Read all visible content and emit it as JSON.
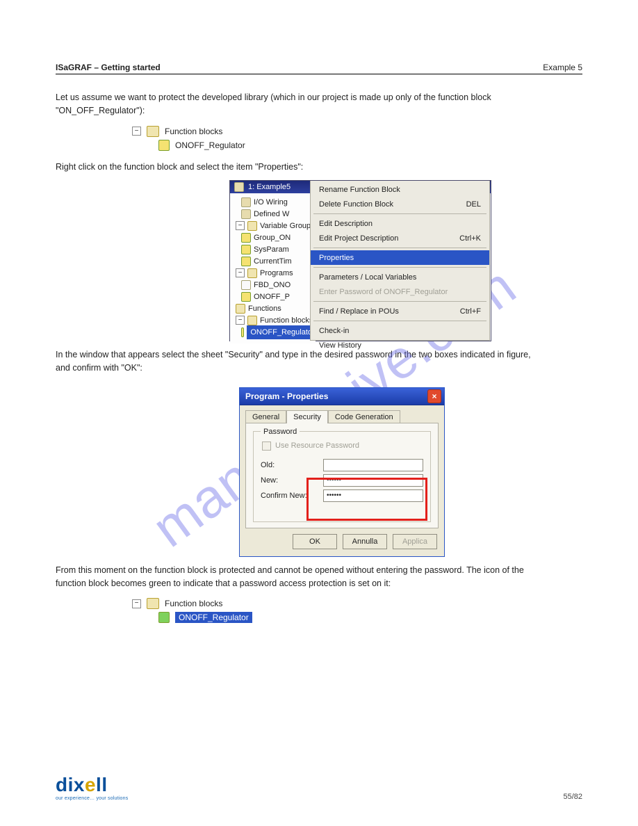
{
  "header": {
    "left": "ISaGRAF – Getting started",
    "right": "Example 5"
  },
  "para1": "Let us assume we want to protect the developed library (which in our project is made up only of the function block \"ON_OFF_Regulator\"):",
  "tree_mini1": {
    "parent": "Function blocks",
    "child": "ONOFF_Regulator"
  },
  "para2": "Right click on the function block and select the item \"Properties\":",
  "shot1": {
    "title": "1: Example5",
    "tree": [
      {
        "label": "I/O Wiring",
        "lvl": 1,
        "icon": "tan"
      },
      {
        "label": "Defined W",
        "lvl": 1,
        "icon": "tan"
      },
      {
        "label": "Variable Groups",
        "lvl": 0,
        "icon": "folder",
        "collapsible": true
      },
      {
        "label": "Group_ON",
        "lvl": 1,
        "icon": "yellow"
      },
      {
        "label": "SysParam",
        "lvl": 1,
        "icon": "yellow"
      },
      {
        "label": "CurrentTim",
        "lvl": 1,
        "icon": "yellow"
      },
      {
        "label": "Programs",
        "lvl": 0,
        "icon": "folder",
        "collapsible": true
      },
      {
        "label": "FBD_ONO",
        "lvl": 1,
        "icon": "white"
      },
      {
        "label": "ONOFF_P",
        "lvl": 1,
        "icon": "yellow"
      },
      {
        "label": "Functions",
        "lvl": 0,
        "icon": "folder"
      },
      {
        "label": "Function blocks",
        "lvl": 0,
        "icon": "folder",
        "collapsible": true
      },
      {
        "label": "ONOFF_Regulato",
        "lvl": 1,
        "icon": "yellow",
        "selected": true
      }
    ],
    "ctx": [
      {
        "label": "Rename Function Block"
      },
      {
        "label": "Delete Function Block",
        "sh": "DEL"
      },
      {
        "sep": true
      },
      {
        "label": "Edit Description"
      },
      {
        "label": "Edit Project Description",
        "sh": "Ctrl+K"
      },
      {
        "sep": true
      },
      {
        "label": "Properties",
        "selected": true
      },
      {
        "sep": true
      },
      {
        "label": "Parameters / Local Variables"
      },
      {
        "label": "Enter Password of ONOFF_Regulator",
        "disabled": true
      },
      {
        "sep": true
      },
      {
        "label": "Find / Replace in POUs",
        "sh": "Ctrl+F"
      },
      {
        "sep": true
      },
      {
        "label": "Check-in"
      },
      {
        "label": "View History"
      }
    ]
  },
  "para3": "In the window that appears select the sheet \"Security\" and type in the desired password in the two boxes indicated in figure, and confirm with \"OK\":",
  "shot2": {
    "title": "Program - Properties",
    "tabs": [
      "General",
      "Security",
      "Code Generation"
    ],
    "group": "Password",
    "checkbox": "Use Resource Password",
    "rows": [
      {
        "label": "Old:",
        "value": ""
      },
      {
        "label": "New:",
        "value": "••••••"
      },
      {
        "label": "Confirm New:",
        "value": "••••••"
      }
    ],
    "buttons": {
      "ok": "OK",
      "cancel": "Annulla",
      "apply": "Applica"
    }
  },
  "para4": "From this moment on the function block is protected and cannot be opened without entering the password. The icon of the function block becomes green to indicate that a password access protection is set on it:",
  "tree_mini2": {
    "parent": "Function blocks",
    "child": "ONOFF_Regulator"
  },
  "watermark": "manualshive.com",
  "footer": {
    "brand_pre": "dix",
    "brand_e": "e",
    "brand_post": "ll",
    "tag": "our experience… your solutions",
    "pageno": "55/82"
  }
}
